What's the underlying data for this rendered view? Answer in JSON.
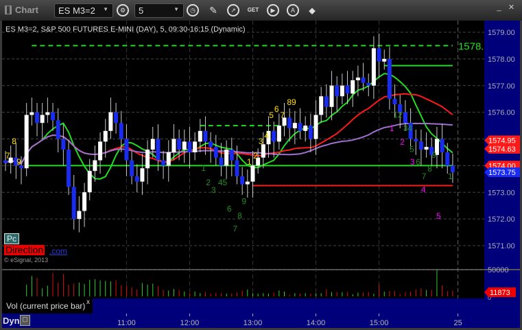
{
  "window": {
    "title": "Chart",
    "minimize": "_",
    "close": "✕"
  },
  "toolbar": {
    "symbol": "ES M3=2",
    "interval": "5",
    "icons": [
      "settings-gear-icon",
      "clock-icon",
      "pencil-icon",
      "study-icon",
      "get-data-icon",
      "play-icon",
      "alert-icon",
      "link-icon"
    ]
  },
  "chart_title": "ES M3=2, S&P 500 FUTURES E-MINI (DAY), 5, 09:30-16:15 (Dynamic)",
  "branding": {
    "pc": "Pc",
    "direction": "Direction",
    "com": ".com",
    "copyright": "© eSignal, 2013"
  },
  "volume_pane": {
    "legend": "Vol (current price bar)",
    "close": "x",
    "labels": [
      "50000",
      "0"
    ],
    "tag": "11873"
  },
  "bottom": {
    "dyn": "Dyn",
    "lock": "🔒"
  },
  "colors": {
    "up": "#ffffff",
    "down": "#1a2cf0",
    "ma_fast": "#22dd22",
    "ma_mid": "#ff1a1a",
    "ma_slow": "#a070d0",
    "axis_bg": "#00007a"
  },
  "chart_data": {
    "type": "candlestick",
    "ylim": [
      1570.6,
      1579.4
    ],
    "y_ticks": [
      "1579.00",
      "1578.00",
      "1577.00",
      "1576.00",
      "1575.00",
      "1574.00",
      "1573.00",
      "1572.00",
      "1571.00"
    ],
    "x_ticks": [
      {
        "label": "11:00",
        "bar": 23
      },
      {
        "label": "12:00",
        "bar": 35
      },
      {
        "label": "13:00",
        "bar": 47
      },
      {
        "label": "14:00",
        "bar": 59
      },
      {
        "label": "15:00",
        "bar": 71
      },
      {
        "label": "25",
        "bar": 86
      }
    ],
    "first_open": 1574.2,
    "closes": [
      1574.1,
      1574.3,
      1574.0,
      1573.9,
      1575.9,
      1576.0,
      1575.6,
      1575.9,
      1576.0,
      1575.7,
      1575.0,
      1574.6,
      1573.2,
      1572.0,
      1572.3,
      1573.0,
      1573.8,
      1574.2,
      1574.9,
      1575.3,
      1576.0,
      1575.6,
      1575.0,
      1574.2,
      1573.6,
      1573.4,
      1573.9,
      1574.6,
      1575.0,
      1574.2,
      1574.0,
      1574.5,
      1575.0,
      1574.6,
      1574.9,
      1574.5,
      1574.9,
      1575.3,
      1574.9,
      1574.7,
      1574.3,
      1574.0,
      1574.6,
      1574.2,
      1573.6,
      1573.3,
      1573.4,
      1574.0,
      1574.3,
      1574.8,
      1575.3,
      1574.9,
      1575.5,
      1575.8,
      1575.4,
      1575.6,
      1575.3,
      1575.5,
      1575.0,
      1575.9,
      1576.6,
      1576.2,
      1577.0,
      1576.6,
      1577.0,
      1576.7,
      1577.2,
      1577.3,
      1577.1,
      1577.0,
      1578.4,
      1577.9,
      1578.0,
      1576.5,
      1576.3,
      1576.0,
      1575.6,
      1575.0,
      1574.9,
      1574.6,
      1574.7,
      1574.4,
      1575.0,
      1574.5,
      1574.0,
      1573.75
    ],
    "volume": [
      22000,
      38000,
      35000,
      15000,
      20000,
      44000,
      26000,
      42000,
      22000,
      24000,
      26000,
      23000,
      31000,
      32000,
      30000,
      29000,
      28000,
      30000,
      21000,
      20000,
      17000,
      13000,
      25000,
      22000,
      24000,
      19000,
      12000,
      11000,
      14000,
      12000,
      9000,
      6000,
      9000,
      6000,
      8000,
      5000,
      7000,
      6000,
      5000,
      5000,
      7000,
      11000,
      13000,
      6000,
      5000,
      6000,
      5000,
      7000,
      11000,
      9000,
      3000,
      6000,
      5000,
      6000,
      5000,
      6000,
      6000,
      13000,
      8000,
      8000,
      8000,
      8000,
      4000,
      7000,
      7000,
      8000,
      5000,
      22000,
      9000,
      10000,
      10000,
      4000,
      8000,
      9000,
      13000,
      15000,
      12000,
      12000,
      50000,
      21000,
      10000,
      11000
    ],
    "moving_averages": [
      {
        "name": "fast",
        "period": 8
      },
      {
        "name": "mid",
        "period": 20
      },
      {
        "name": "slow",
        "period": 45
      }
    ],
    "levels": [
      {
        "price": 1578.5,
        "from": 5,
        "to": 85,
        "color": "#22dd22",
        "dashed": true,
        "label": "1578."
      },
      {
        "price": 1577.75,
        "from": 72,
        "to": 85,
        "color": "#22dd22",
        "dashed": false
      },
      {
        "price": 1575.5,
        "from": 37,
        "to": 53,
        "color": "#22dd22",
        "dashed": true
      },
      {
        "price": 1574.0,
        "from": 4,
        "to": 85,
        "color": "#22dd22",
        "dashed": false
      },
      {
        "price": 1573.25,
        "from": 47,
        "to": 85,
        "color": "#ff1a1a",
        "dashed": false
      }
    ],
    "counts": [
      {
        "t": "8",
        "bar": 1.2,
        "price": 1574.91,
        "color": "#ffe000"
      },
      {
        "t": "7",
        "bar": 0,
        "price": 1574.37,
        "color": "#ffe000"
      },
      {
        "t": "9",
        "bar": 2.1,
        "price": 1574.14,
        "color": "#ffe000"
      },
      {
        "t": "1",
        "bar": 45.9,
        "price": 1574.14,
        "color": "#ffe000"
      },
      {
        "t": "2",
        "bar": 47.1,
        "price": 1574.37,
        "color": "#ffe000"
      },
      {
        "t": "3",
        "bar": 48.1,
        "price": 1574.91,
        "color": "#ffe000"
      },
      {
        "t": "4",
        "bar": 49.2,
        "price": 1575.11,
        "color": "#ffe000"
      },
      {
        "t": "5",
        "bar": 50.1,
        "price": 1575.89,
        "color": "#ffe000"
      },
      {
        "t": "6",
        "bar": 51.1,
        "price": 1576.12,
        "color": "#ffe000"
      },
      {
        "t": "7",
        "bar": 52.2,
        "price": 1575.89,
        "color": "#ffe000"
      },
      {
        "t": "89",
        "bar": 53.5,
        "price": 1576.37,
        "color": "#ffe000"
      },
      {
        "t": "1",
        "bar": 37.2,
        "price": 1573.91,
        "color": "#1f8f1f"
      },
      {
        "t": "2",
        "bar": 38.1,
        "price": 1573.37,
        "color": "#1f8f1f"
      },
      {
        "t": "3",
        "bar": 39.1,
        "price": 1573.09,
        "color": "#1f8f1f"
      },
      {
        "t": "45",
        "bar": 40.4,
        "price": 1573.37,
        "color": "#1f8f1f"
      },
      {
        "t": "6",
        "bar": 42.1,
        "price": 1572.37,
        "color": "#1f8f1f"
      },
      {
        "t": "9",
        "bar": 44.9,
        "price": 1572.66,
        "color": "#1f8f1f"
      },
      {
        "t": "8",
        "bar": 44.1,
        "price": 1572.12,
        "color": "#1f8f1f"
      },
      {
        "t": "7",
        "bar": 43.2,
        "price": 1571.63,
        "color": "#1f8f1f"
      },
      {
        "t": "12",
        "bar": 73.7,
        "price": 1575.9,
        "color": "#1f8f1f"
      },
      {
        "t": "34",
        "bar": 75.6,
        "price": 1575.4,
        "color": "#1f8f1f"
      },
      {
        "t": "5",
        "bar": 76.8,
        "price": 1574.62,
        "color": "#1f8f1f"
      },
      {
        "t": "6",
        "bar": 78,
        "price": 1574.14,
        "color": "#1f8f1f"
      },
      {
        "t": "8",
        "bar": 80.2,
        "price": 1573.88,
        "color": "#1f8f1f"
      },
      {
        "t": "7",
        "bar": 79.1,
        "price": 1573.6,
        "color": "#1f8f1f"
      },
      {
        "t": "9",
        "bar": 81,
        "price": 1574.4,
        "color": "#1f8f1f"
      },
      {
        "t": "1",
        "bar": 84.1,
        "price": 1573.6,
        "color": "#1f8f1f"
      },
      {
        "t": "1",
        "bar": 73,
        "price": 1575.4,
        "color": "#ff00ff"
      },
      {
        "t": "2",
        "bar": 75,
        "price": 1574.88,
        "color": "#ff00ff"
      },
      {
        "t": "3",
        "bar": 76.9,
        "price": 1574.14,
        "color": "#ff00ff"
      },
      {
        "t": "4",
        "bar": 79,
        "price": 1573.1,
        "color": "#ff00ff"
      },
      {
        "t": "5",
        "bar": 81.9,
        "price": 1572.1,
        "color": "#ff00ff"
      }
    ],
    "price_tags": [
      {
        "t": "1574.95",
        "price": 1574.95,
        "color": "#ff1a1a"
      },
      {
        "t": "1574.63",
        "price": 1574.63,
        "color": "#ff1a1a"
      },
      {
        "t": "1574.00",
        "price": 1574.0,
        "color": "#ff1a1a"
      },
      {
        "t": "1573.75",
        "price": 1573.75,
        "color": "#1a2cf0"
      }
    ]
  }
}
